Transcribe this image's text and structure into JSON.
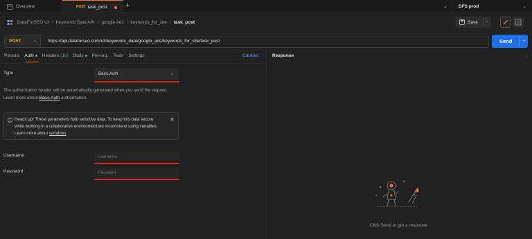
{
  "tabs": {
    "overview": "Overview",
    "active": {
      "method": "POST",
      "name": "task_post"
    },
    "new_tab": "+"
  },
  "environment": {
    "name": "DFS prod"
  },
  "breadcrumb": {
    "items": [
      "DataForSEO v3",
      "Keywords Data API",
      "google Ads",
      "keywords_for_site"
    ],
    "current": "task_post",
    "separator": "/"
  },
  "toolbar": {
    "save_label": "Save"
  },
  "request": {
    "method": "POST",
    "url": "https://api.dataforseo.com/v3/keywords_data/google_ads/keywords_for_site/task_post",
    "send_label": "Send"
  },
  "request_tabs": {
    "params": "Params",
    "auth": "Auth",
    "headers": "Headers",
    "headers_count": "(10)",
    "body": "Body",
    "prereq": "Pre-req.",
    "tests": "Tests",
    "settings": "Settings",
    "cookies": "Cookies"
  },
  "auth": {
    "type_label": "Type",
    "type_value": "Basic Auth",
    "description_line1": "The authorization header will be automatically generated when you send the request.",
    "learn_more_prefix": "Learn more about ",
    "learn_more_link": "Basic Auth",
    "learn_more_suffix": " authorization.",
    "alert_line1": "Heads up! These parameters hold sensitive data. To keep this data secure",
    "alert_line2": "while working in a collaborative environment,we recommend using variables.",
    "alert_line3_prefix": "Learn more about ",
    "alert_line3_link": "variables",
    "alert_line3_suffix": ".",
    "username_label": "Username",
    "username_placeholder": "Username",
    "password_label": "Password",
    "password_placeholder": "Password"
  },
  "response": {
    "title": "Response",
    "empty_hint": "Click Send to get a response"
  },
  "colors": {
    "accent": "#ff6c37",
    "send": "#1f6feb",
    "method_post": "#e8b000",
    "highlight_red": "#d9281f"
  }
}
